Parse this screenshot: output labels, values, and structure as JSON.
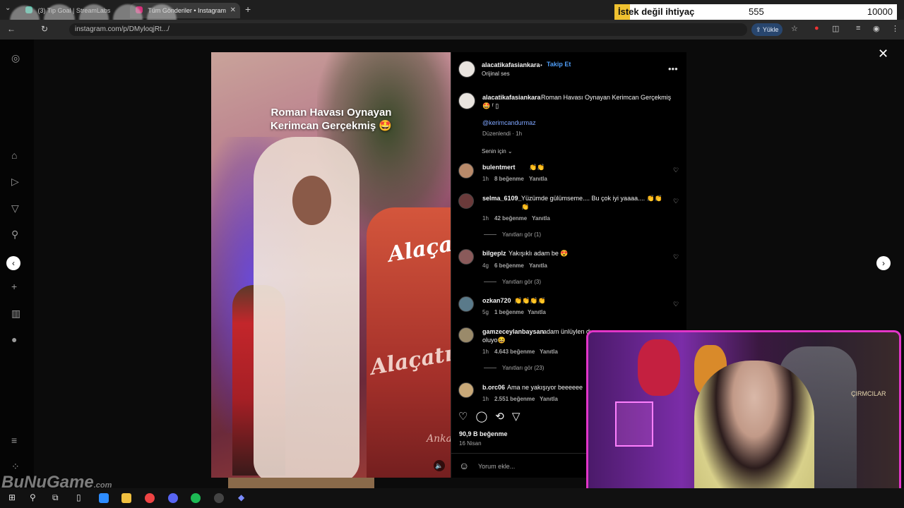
{
  "browser": {
    "tabs": [
      {
        "title": "(3) Tip Goal | StreamLabs"
      },
      {
        "title": "Tüm Gönderiler • Instagram"
      }
    ],
    "url": "instagram.com/p/DMyloqjRt.../",
    "upload_label": "Yükle"
  },
  "overlay": {
    "label": "İstek değil ihtiyaç",
    "current": "555",
    "goal": "10000"
  },
  "post": {
    "username": "alacatikafasiankara",
    "follow": "Takip Et",
    "audio": "Orijinal ses",
    "video_caption": "Roman Havası Oynayan Kerimcan Gerçekmiş 🤩",
    "brand_text": "Alaçatı",
    "brand_sub": "Ankara",
    "caption_text": "Roman Havası Oynayan Kerimcan Gerçekmiş",
    "caption_emoji": "🤩 ᶠ ▯",
    "mention": "@kerimcandurmaz",
    "edited": "Düzenlendi · 1h",
    "sort": "Senin için",
    "likes": "90,9 B beğenme",
    "date": "16 Nisan",
    "comment_placeholder": "Yorum ekle..."
  },
  "comments": [
    {
      "user": "bulentmert",
      "text": "👏👏",
      "time": "1h",
      "likes": "8 beğenme",
      "reply": "Yanıtla"
    },
    {
      "user": "selma_6109_",
      "text": "Yüzümde gülümseme.... Bu çok iyi yaaaa.... 👏👏👏",
      "time": "1h",
      "likes": "42 beğenme",
      "reply": "Yanıtla",
      "replies": "Yanıtları gör (1)"
    },
    {
      "user": "bilgeplz",
      "text": "Yakışıklı adam be 😍",
      "time": "4g",
      "likes": "6 beğenme",
      "reply": "Yanıtla",
      "replies": "Yanıtları gör (3)"
    },
    {
      "user": "ozkan720",
      "text": "👏👏👏👏",
      "time": "5g",
      "likes": "1 beğenme",
      "reply": "Yanıtla"
    },
    {
      "user": "gamzeceylanbaysan",
      "text": "adam ünlüylen du...",
      "text2": "oluyo😆",
      "time": "1h",
      "likes": "4.643 beğenme",
      "reply": "Yanıtla",
      "replies": "Yanıtları gör (23)"
    },
    {
      "user": "b.orc06",
      "text": "Ama ne yakışıyor beeeeee",
      "time": "1h",
      "likes": "2.551 beğenme",
      "reply": "Yanıtla"
    }
  ],
  "webcam": {
    "sign": "ÇIRMCILAR"
  },
  "watermark": {
    "brand": "BuNuGame",
    "suffix": ".com"
  },
  "colors": {
    "accent": "#e235c8",
    "link": "#7fa6ff",
    "goal_bar": "#f0c230"
  }
}
